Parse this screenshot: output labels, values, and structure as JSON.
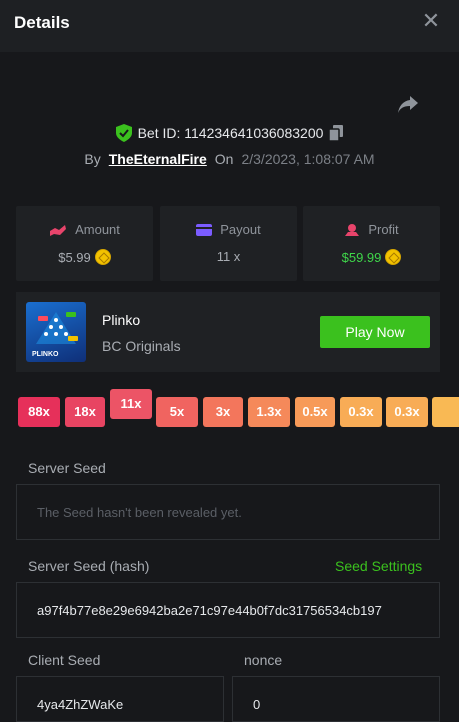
{
  "header": {
    "title": "Details",
    "close_icon": "close-icon"
  },
  "bet": {
    "id_text": "Bet ID: 114234641036083200",
    "by_label": "By",
    "username": "TheEternalFire",
    "on_label": "On",
    "date": "2/3/2023, 1:08:07 AM"
  },
  "stats": {
    "amount": {
      "label": "Amount",
      "value": "$5.99"
    },
    "payout": {
      "label": "Payout",
      "value": "11 x"
    },
    "profit": {
      "label": "Profit",
      "value": "$59.99"
    }
  },
  "game": {
    "name": "Plinko",
    "provider": "BC Originals",
    "play_label": "Play Now",
    "thumb_text": "PLINKO"
  },
  "multipliers": [
    "88x",
    "18x",
    "11x",
    "5x",
    "3x",
    "1.3x",
    "0.5x",
    "0.3x",
    "0.3x"
  ],
  "server_seed": {
    "label": "Server Seed",
    "placeholder": "The Seed hasn't been revealed yet."
  },
  "server_seed_hash": {
    "label": "Server Seed (hash)",
    "settings_link": "Seed Settings",
    "value": "a97f4b77e8e29e6942ba2e71c97e44b0f7dc31756534cb197"
  },
  "client_seed": {
    "label": "Client Seed",
    "value": "4ya4ZhZWaKe"
  },
  "nonce": {
    "label": "nonce",
    "value": "0"
  },
  "colors": {
    "accent_green": "#3bc11e",
    "profit_green": "#3fd64a",
    "bg": "#17181b",
    "panel": "#1f2124"
  }
}
